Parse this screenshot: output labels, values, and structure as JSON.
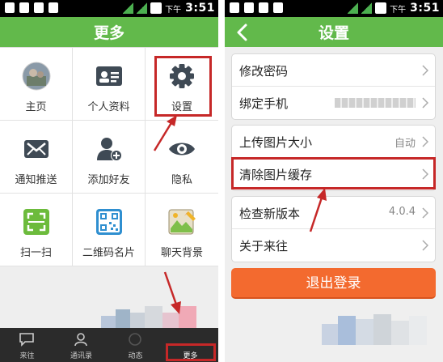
{
  "status_bar": {
    "time_prefix": "下午",
    "time": "3:51"
  },
  "more_screen": {
    "title": "更多",
    "grid": [
      {
        "label": "主页",
        "icon": "avatar-photo"
      },
      {
        "label": "个人资料",
        "icon": "id-card-icon"
      },
      {
        "label": "设置",
        "icon": "gear-icon"
      },
      {
        "label": "通知推送",
        "icon": "mail-icon"
      },
      {
        "label": "添加好友",
        "icon": "add-person-icon"
      },
      {
        "label": "隐私",
        "icon": "eye-icon"
      },
      {
        "label": "扫一扫",
        "icon": "scan-icon"
      },
      {
        "label": "二维码名片",
        "icon": "qr-code-icon"
      },
      {
        "label": "聊天背景",
        "icon": "chat-background-icon"
      }
    ],
    "bottom_nav": [
      {
        "label": "来往",
        "icon": "chat-bubble-icon"
      },
      {
        "label": "通讯录",
        "icon": "contacts-icon"
      },
      {
        "label": "动态",
        "icon": "moments-icon"
      },
      {
        "label": "更多",
        "icon": "more-icon"
      }
    ]
  },
  "settings_screen": {
    "title": "设置",
    "groups": [
      [
        {
          "label": "修改密码"
        },
        {
          "label": "绑定手机"
        }
      ],
      [
        {
          "label": "上传图片大小",
          "value": "自动"
        },
        {
          "label": "清除图片缓存"
        }
      ],
      [
        {
          "label": "检查新版本",
          "value": "4.0.4"
        },
        {
          "label": "关于来往"
        }
      ]
    ],
    "logout_label": "退出登录"
  },
  "colors": {
    "green_bar": "#62b94b",
    "logout": "#f36a2f",
    "highlight": "#c62828"
  }
}
